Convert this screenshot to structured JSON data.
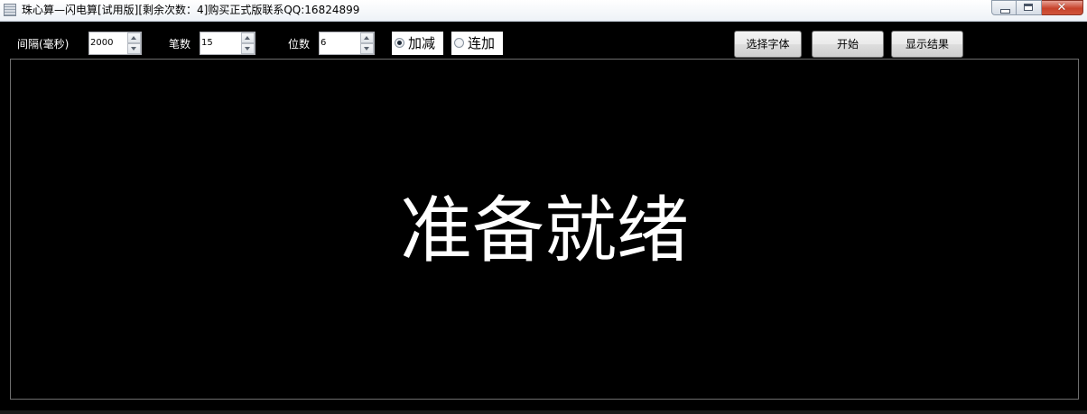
{
  "window": {
    "title": "珠心算—闪电算[试用版][剩余次数：4]购买正式版联系QQ:16824899",
    "icon": "calculator-app-icon"
  },
  "toolbar": {
    "interval": {
      "label": "间隔(毫秒)",
      "value": "2000"
    },
    "count": {
      "label": "笔数",
      "value": "15"
    },
    "digits": {
      "label": "位数",
      "value": "6"
    },
    "mode": {
      "options": [
        {
          "label": "加减",
          "checked": true
        },
        {
          "label": "连加",
          "checked": false
        }
      ]
    },
    "buttons": {
      "select_font": "选择字体",
      "start": "开始",
      "show_result": "显示结果"
    }
  },
  "display": {
    "text": "准备就绪",
    "text_color": "#ffffff",
    "background_color": "#000000"
  }
}
